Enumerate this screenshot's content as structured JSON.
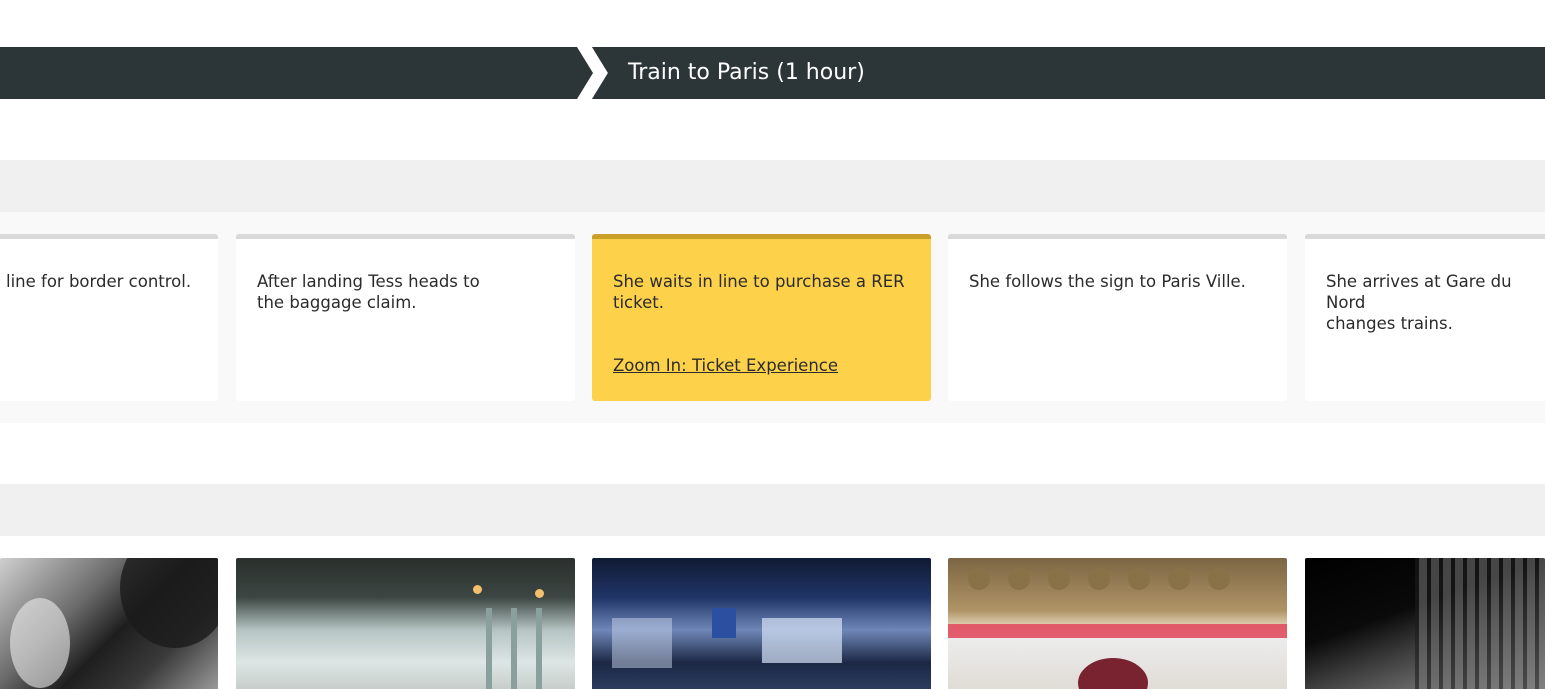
{
  "phases": {
    "current_title": "Train to Paris (1 hour)"
  },
  "cards": [
    {
      "text": "line for border control."
    },
    {
      "text": "After landing Tess heads to\nthe baggage claim."
    },
    {
      "text": "She waits in line to purchase a RER ticket.",
      "link": "Zoom In: Ticket Experience "
    },
    {
      "text": "She follows the sign to Paris Ville."
    },
    {
      "text": "She arrives at Gare du Nord\nchanges trains."
    }
  ],
  "colors": {
    "phase_bar": "#2c3638",
    "highlight_card": "#fdd24a",
    "highlight_border": "#cc9f2b",
    "lane_header": "#f0f0f0"
  }
}
